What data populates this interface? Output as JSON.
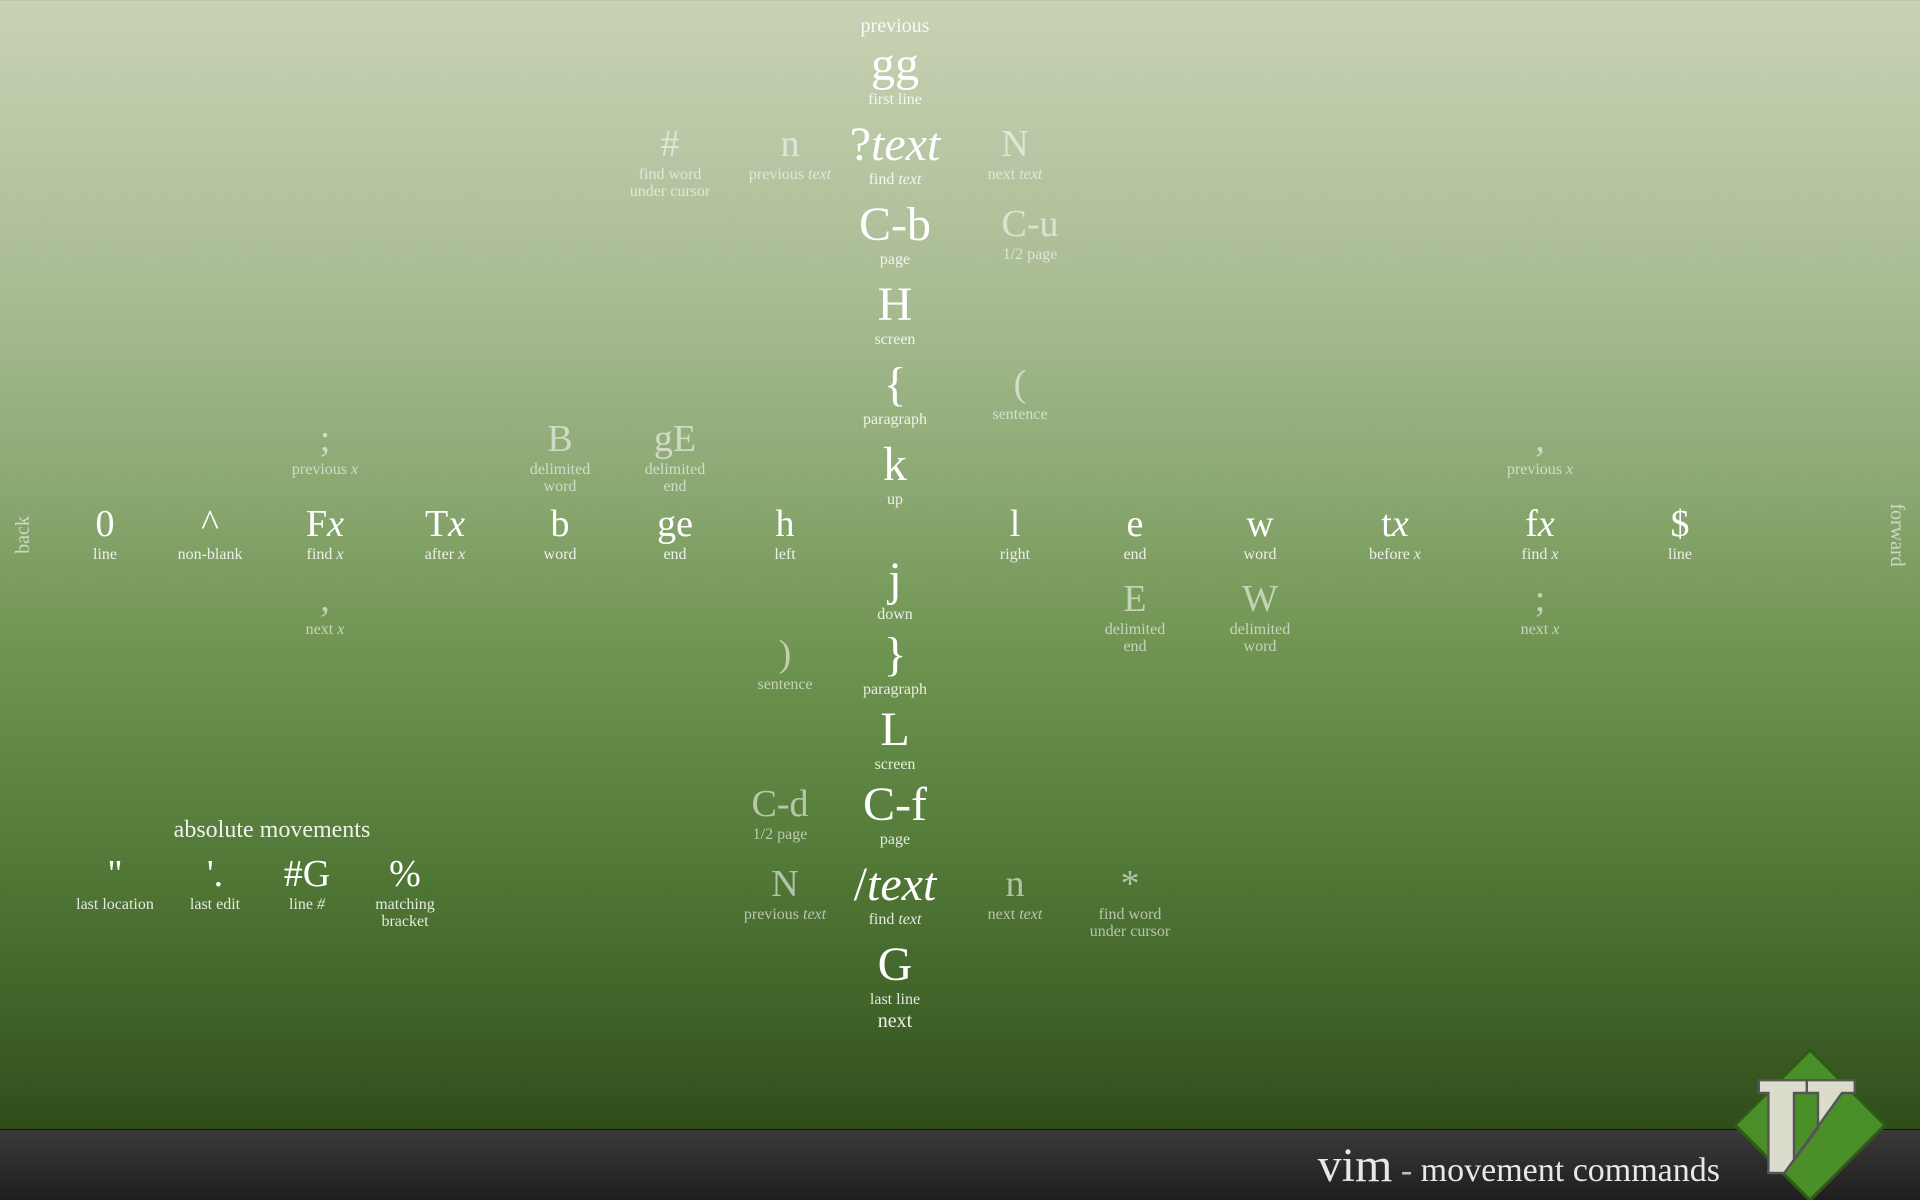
{
  "headers": {
    "previous": "previous",
    "next": "next",
    "back": "back",
    "forward": "forward"
  },
  "center": {
    "gg": {
      "key": "gg",
      "sub": "first line"
    },
    "qtext": {
      "key": "?",
      "ital": "text",
      "sub": "find ",
      "subital": "text"
    },
    "cb": {
      "key": "C-b",
      "sub": "page"
    },
    "H": {
      "key": "H",
      "sub": "screen"
    },
    "lbrace": {
      "key": "{",
      "sub": "paragraph"
    },
    "k": {
      "key": "k",
      "sub": "up"
    },
    "j": {
      "key": "j",
      "sub": "down"
    },
    "rbrace": {
      "key": "}",
      "sub": "paragraph"
    },
    "L": {
      "key": "L",
      "sub": "screen"
    },
    "cf": {
      "key": "C-f",
      "sub": "page"
    },
    "stext": {
      "key": "/",
      "ital": "text",
      "sub": "find ",
      "subital": "text"
    },
    "G": {
      "key": "G",
      "sub": "last line"
    }
  },
  "up_side": {
    "hash": {
      "key": "#",
      "sub": "find word",
      "sub2": "under cursor"
    },
    "n_up": {
      "key": "n",
      "sub": "previous ",
      "subital": "text"
    },
    "N_up": {
      "key": "N",
      "sub": "next ",
      "subital": "text"
    },
    "cu": {
      "key": "C-u",
      "sub": "1/2 page"
    },
    "lparen": {
      "key": "(",
      "sub": "sentence"
    }
  },
  "down_side": {
    "rparen": {
      "key": ")",
      "sub": "sentence"
    },
    "cd": {
      "key": "C-d",
      "sub": "1/2 page"
    },
    "N_dn": {
      "key": "N",
      "sub": "previous ",
      "subital": "text"
    },
    "n_dn": {
      "key": "n",
      "sub": "next ",
      "subital": "text"
    },
    "star": {
      "key": "*",
      "sub": "find word",
      "sub2": "under cursor"
    }
  },
  "hrow": {
    "zero": {
      "key": "0",
      "sub": "line"
    },
    "caret": {
      "key": "^",
      "sub": "non-blank"
    },
    "Fx": {
      "key": "F",
      "ital": "x",
      "sub": "find ",
      "subital": "x"
    },
    "Tx": {
      "key": "T",
      "ital": "x",
      "sub": "after ",
      "subital": "x"
    },
    "b": {
      "key": "b",
      "sub": "word"
    },
    "ge": {
      "key": "ge",
      "sub": "end"
    },
    "h": {
      "key": "h",
      "sub": "left"
    },
    "l": {
      "key": "l",
      "sub": "right"
    },
    "e": {
      "key": "e",
      "sub": "end"
    },
    "w": {
      "key": "w",
      "sub": "word"
    },
    "tx": {
      "key": "t",
      "ital": "x",
      "sub": "before ",
      "subital": "x"
    },
    "fx": {
      "key": "f",
      "ital": "x",
      "sub": "find ",
      "subital": "x"
    },
    "dollar": {
      "key": "$",
      "sub": "line"
    }
  },
  "hrow_upper": {
    "semiL": {
      "key": ";",
      "sub": "previous ",
      "subital": "x"
    },
    "B": {
      "key": "B",
      "sub": "delimited",
      "sub2": "word"
    },
    "gE": {
      "key": "gE",
      "sub": "delimited",
      "sub2": "end"
    },
    "commaR": {
      "key": ",",
      "sub": "previous ",
      "subital": "x"
    }
  },
  "hrow_lower": {
    "commaL": {
      "key": ",",
      "sub": "next ",
      "subital": "x"
    },
    "E": {
      "key": "E",
      "sub": "delimited",
      "sub2": "end"
    },
    "W": {
      "key": "W",
      "sub": "delimited",
      "sub2": "word"
    },
    "semiR": {
      "key": ";",
      "sub": "next ",
      "subital": "x"
    }
  },
  "abs": {
    "title": "absolute movements",
    "tick": {
      "key": "''",
      "sub": "last location"
    },
    "dot": {
      "key": "'.",
      "sub": "last edit"
    },
    "hashG": {
      "key": "#G",
      "sub": "line ",
      "subital": "#"
    },
    "pct": {
      "key": "%",
      "sub": "matching",
      "sub2": "bracket"
    }
  },
  "footer": {
    "vim": "vim",
    "dash": " - ",
    "sub": "movement commands"
  }
}
